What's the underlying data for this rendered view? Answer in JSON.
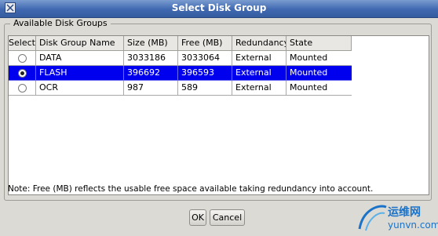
{
  "window": {
    "title": "Select Disk Group"
  },
  "group": {
    "label": "Available Disk Groups"
  },
  "table": {
    "columns": [
      "Select",
      "Disk Group Name",
      "Size (MB)",
      "Free (MB)",
      "Redundancy",
      "State"
    ],
    "rows": [
      {
        "name": "DATA",
        "size": "3033186",
        "free": "3033064",
        "redundancy": "External",
        "state": "Mounted",
        "selected": false
      },
      {
        "name": "FLASH",
        "size": "396692",
        "free": "396593",
        "redundancy": "External",
        "state": "Mounted",
        "selected": true
      },
      {
        "name": "OCR",
        "size": "987",
        "free": "589",
        "redundancy": "External",
        "state": "Mounted",
        "selected": false
      }
    ]
  },
  "note": "Note:  Free (MB) reflects the usable free space available taking redundancy into account.",
  "buttons": {
    "ok": "OK",
    "cancel": "Cancel"
  },
  "watermark": {
    "text_cn": "运维网",
    "text_url": "yunvn.com"
  },
  "colors": {
    "title_bar": "#3f68b0",
    "selected_row": "#0000ee"
  }
}
